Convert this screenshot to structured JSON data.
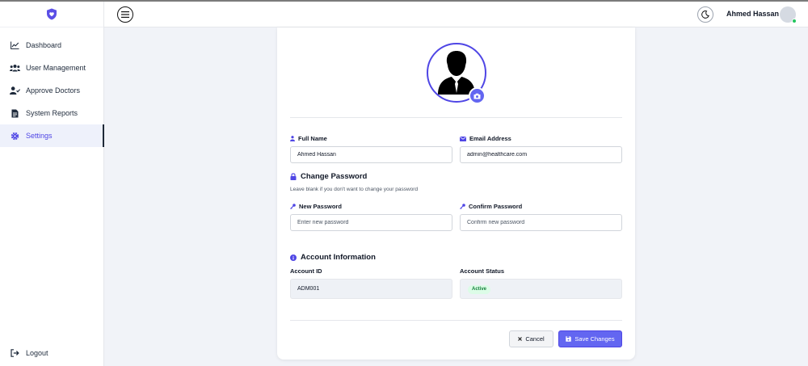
{
  "sidebar": {
    "items": [
      {
        "label": "Dashboard",
        "icon": "chart-line-icon"
      },
      {
        "label": "User Management",
        "icon": "users-icon"
      },
      {
        "label": "Approve Doctors",
        "icon": "user-check-icon"
      },
      {
        "label": "System Reports",
        "icon": "report-icon"
      },
      {
        "label": "Settings",
        "icon": "gear-icon",
        "active": true
      }
    ],
    "logout_label": "Logout"
  },
  "header": {
    "username": "Ahmed Hassan"
  },
  "form": {
    "full_name_label": "Full Name",
    "full_name_value": "Ahmed Hassan",
    "email_label": "Email Address",
    "email_value": "admin@healthcare.com",
    "change_password_title": "Change Password",
    "change_password_hint": "Leave blank if you don't want to change your password",
    "new_password_label": "New Password",
    "new_password_placeholder": "Enter new password",
    "confirm_password_label": "Confirm Password",
    "confirm_password_placeholder": "Confirm new password",
    "account_info_title": "Account Information",
    "account_id_label": "Account ID",
    "account_id_value": "ADM001",
    "account_status_label": "Account Status",
    "account_status_value": "Active",
    "cancel_label": "Cancel",
    "save_label": "Save Changes"
  },
  "colors": {
    "accent": "#6366f1",
    "status_active": "#15803d",
    "online": "#22c55e"
  }
}
